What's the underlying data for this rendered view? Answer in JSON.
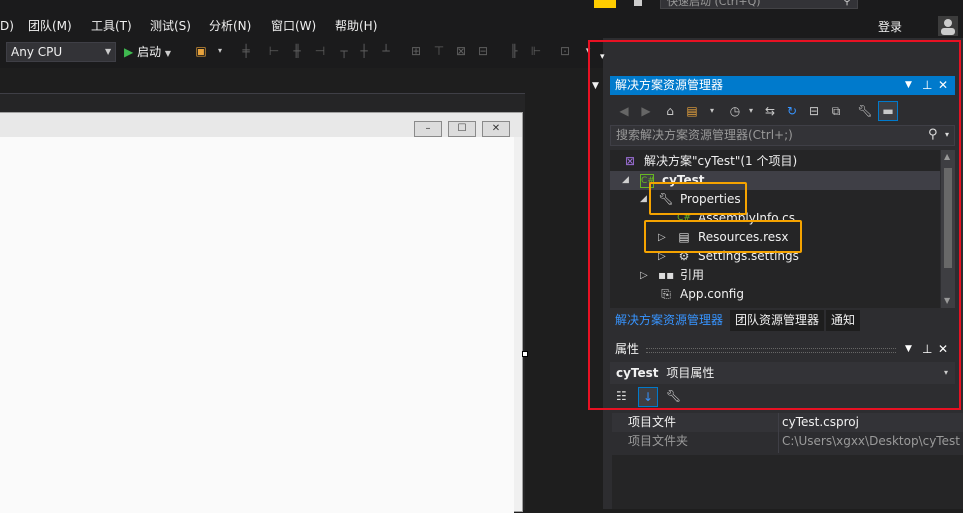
{
  "menubar": {
    "items": [
      "D)",
      "团队(M)",
      "工具(T)",
      "测试(S)",
      "分析(N)",
      "窗口(W)",
      "帮助(H)"
    ],
    "quick_launch_placeholder": "快速启动 (Ctrl+Q)",
    "login_label": "登录"
  },
  "toolbar": {
    "platform_value": "Any CPU",
    "start_label": "启动"
  },
  "designer": {
    "window_buttons": [
      "–",
      "☐",
      "✕"
    ]
  },
  "solution_explorer": {
    "title": "解决方案资源管理器",
    "search_placeholder": "搜索解决方案资源管理器(Ctrl+;)",
    "tree": [
      {
        "label": "解决方案\"cyTest\"(1 个项目)",
        "icon": "solution-icon",
        "expanded": null
      },
      {
        "label": "cyTest",
        "icon": "csharp-project-icon",
        "expanded": true,
        "selected": true
      },
      {
        "label": "Properties",
        "icon": "wrench-icon",
        "expanded": true
      },
      {
        "label": "AssemblyInfo.cs",
        "icon": "csharp-file-icon",
        "expanded": null
      },
      {
        "label": "Resources.resx",
        "icon": "resource-file-icon",
        "expanded": false
      },
      {
        "label": "Settings.settings",
        "icon": "settings-gear-icon",
        "expanded": false
      },
      {
        "label": "引用",
        "icon": "references-icon",
        "expanded": false
      },
      {
        "label": "App.config",
        "icon": "config-file-icon",
        "expanded": null
      }
    ],
    "bottom_tabs": [
      "解决方案资源管理器",
      "团队资源管理器",
      "通知"
    ],
    "active_tab_color": "#3794ff"
  },
  "properties": {
    "title": "属性",
    "object_name": "cyTest",
    "object_type": "项目属性",
    "rows": [
      {
        "key": "项目文件",
        "value": "cyTest.csproj"
      },
      {
        "key": "项目文件夹",
        "value": "C:\\Users\\xgxx\\Desktop\\cyTest"
      }
    ]
  },
  "highlights": {
    "red": "#e81123",
    "orange": "#f5a300"
  }
}
